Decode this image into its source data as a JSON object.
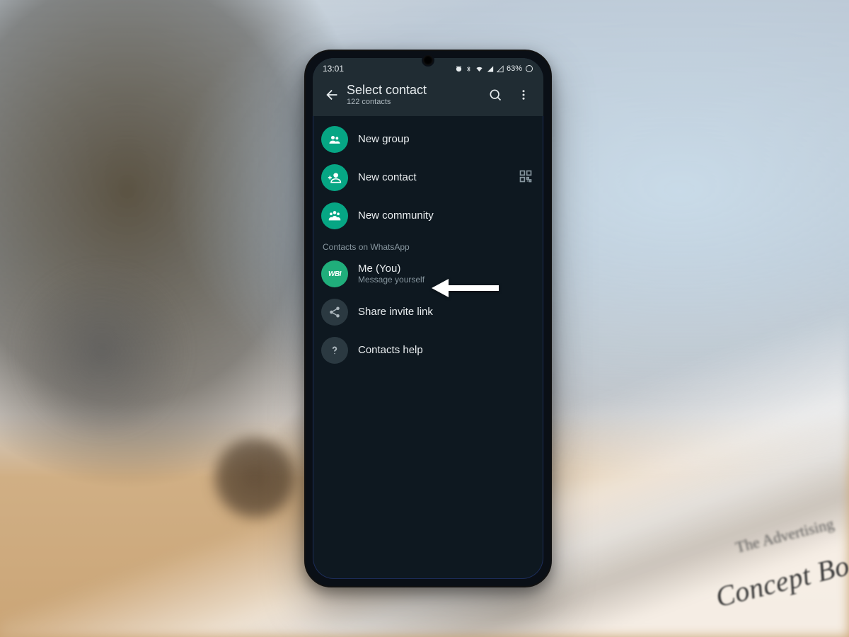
{
  "statusbar": {
    "time": "13:01",
    "battery_text": "63%"
  },
  "appbar": {
    "title": "Select contact",
    "subtitle": "122 contacts"
  },
  "actions": {
    "new_group": "New group",
    "new_contact": "New contact",
    "new_community": "New community"
  },
  "section_header": "Contacts on WhatsApp",
  "me": {
    "avatar_text": "WBI",
    "name": "Me (You)",
    "status": "Message yourself"
  },
  "footer": {
    "share_invite": "Share invite link",
    "contacts_help": "Contacts help"
  },
  "bg_book_title": "Concept Book",
  "bg_book_sub": "The Advertising"
}
